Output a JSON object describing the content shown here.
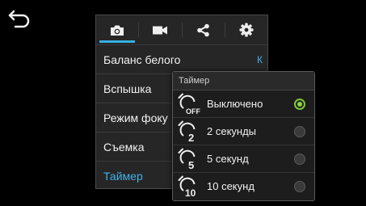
{
  "tabs": [
    {
      "icon": "camera-icon",
      "active": true
    },
    {
      "icon": "video-camera-icon",
      "active": false
    },
    {
      "icon": "share-icon",
      "active": false
    },
    {
      "icon": "gear-icon",
      "active": false
    }
  ],
  "settings": {
    "white_balance": {
      "label": "Баланс белого",
      "value": "К"
    },
    "flash": {
      "label": "Вспышка"
    },
    "focus_mode": {
      "label": "Режим фоку"
    },
    "shooting": {
      "label": "Съемка"
    },
    "timer": {
      "label": "Таймер",
      "selected": true
    }
  },
  "timer_popup": {
    "title": "Таймер",
    "options": [
      {
        "label": "Выключено",
        "icon_text": "OFF",
        "selected": true
      },
      {
        "label": "2 секунды",
        "icon_text": "2",
        "selected": false
      },
      {
        "label": "5 секунд",
        "icon_text": "5",
        "selected": false
      },
      {
        "label": "10 секунд",
        "icon_text": "10",
        "selected": false
      }
    ]
  },
  "colors": {
    "accent": "#34b0e6",
    "selected_radio": "#8ed53f"
  }
}
